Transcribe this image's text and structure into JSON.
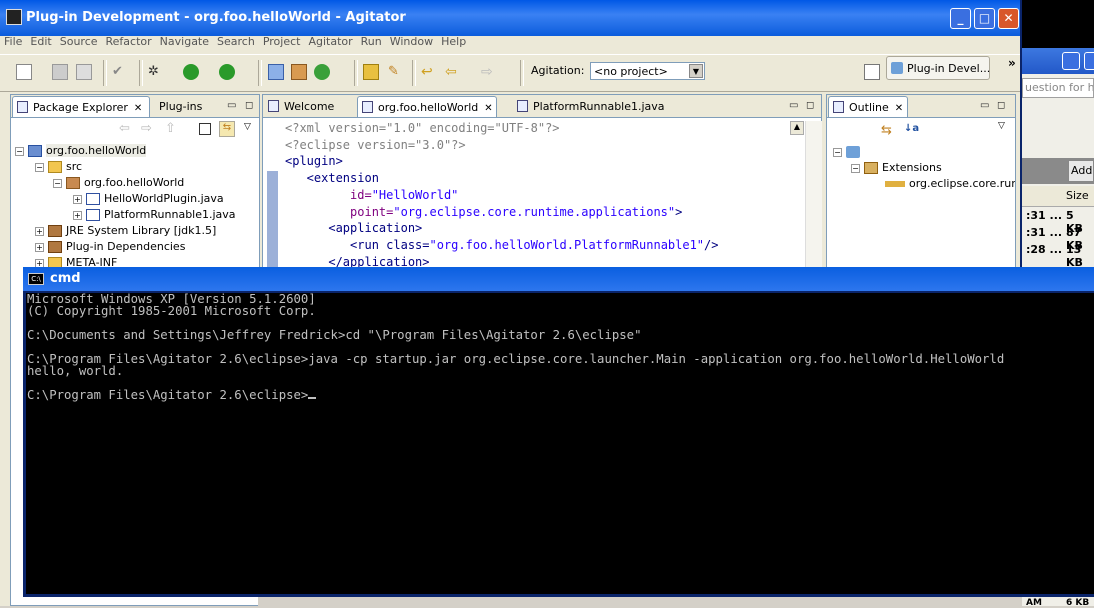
{
  "background_window": {
    "question_field": "uestion for hel",
    "add_button": "Add",
    "size_header": "Size",
    "rows": [
      {
        "time": ":31 ...",
        "size": "5 KB"
      },
      {
        "time": ":31 ...",
        "size": "87 KB"
      },
      {
        "time": ":28 ...",
        "size": "13 KB"
      }
    ],
    "bottom_time": "AM",
    "bottom_size": "6 KB"
  },
  "window": {
    "title": "Plug-in Development - org.foo.helloWorld - Agitator",
    "minimize": "_",
    "maximize": "□",
    "close": "✕"
  },
  "menu": [
    "File",
    "Edit",
    "Source",
    "Refactor",
    "Navigate",
    "Search",
    "Project",
    "Agitator",
    "Run",
    "Window",
    "Help"
  ],
  "toolbar": {
    "agitation_label": "Agitation:",
    "project_combo": "<no project>",
    "perspective": "Plug-in Devel...",
    "overflow": "»"
  },
  "package_explorer": {
    "tabs": [
      {
        "label": "Package Explorer",
        "close": "✕"
      },
      {
        "label": "Plug-ins"
      }
    ],
    "tree": [
      {
        "label": "org.foo.helloWorld",
        "exp": "−",
        "icon": "project-icon",
        "level": 0
      },
      {
        "label": "src",
        "exp": "−",
        "icon": "source-folder-icon",
        "level": 1
      },
      {
        "label": "org.foo.helloWorld",
        "exp": "−",
        "icon": "package-icon",
        "level": 2
      },
      {
        "label": "HelloWorldPlugin.java",
        "exp": "+",
        "icon": "java-file-icon",
        "level": 3
      },
      {
        "label": "PlatformRunnable1.java",
        "exp": "+",
        "icon": "java-file-icon",
        "level": 3
      },
      {
        "label": "JRE System Library [jdk1.5]",
        "exp": "+",
        "icon": "library-icon",
        "level": 1
      },
      {
        "label": "Plug-in Dependencies",
        "exp": "+",
        "icon": "library-icon",
        "level": 1
      },
      {
        "label": "META-INF",
        "exp": "+",
        "icon": "folder-icon",
        "level": 1
      }
    ]
  },
  "editor": {
    "tabs": [
      {
        "label": "Welcome"
      },
      {
        "label": "org.foo.helloWorld",
        "close": "✕"
      },
      {
        "label": "PlatformRunnable1.java"
      }
    ],
    "lines": [
      {
        "t1": "<?xml version=\"1.0\" encoding=\"UTF-8\"?>"
      },
      {
        "t1": "<?eclipse version=\"3.0\"?>"
      },
      {
        "t1": "<plugin>"
      },
      {
        "t1": "   <extension"
      },
      {
        "t1": "         id=",
        "t2": "\"HelloWorld\""
      },
      {
        "t1": "         point=",
        "t2": "\"org.eclipse.core.runtime.applications\"",
        "t3": ">"
      },
      {
        "t1": "      <application>"
      },
      {
        "t1": "         <run class=",
        "t2": "\"org.foo.helloWorld.PlatformRunnable1\"",
        "t3": "/>"
      },
      {
        "t1": "      </application>"
      }
    ]
  },
  "outline": {
    "tab": {
      "label": "Outline",
      "close": "✕"
    },
    "tree": [
      {
        "label": "",
        "level": 0
      },
      {
        "label": "Extensions",
        "level": 1
      },
      {
        "label": "org.eclipse.core.runtime.applications",
        "level": 2
      }
    ]
  },
  "cmd": {
    "title": "cmd",
    "icon_text": "C:\\",
    "output": "Microsoft Windows XP [Version 5.1.2600]\n(C) Copyright 1985-2001 Microsoft Corp.\n\nC:\\Documents and Settings\\Jeffrey Fredrick>cd \"\\Program Files\\Agitator 2.6\\eclipse\"\n\nC:\\Program Files\\Agitator 2.6\\eclipse>java -cp startup.jar org.eclipse.core.launcher.Main -application org.foo.helloWorld.HelloWorld\nhello, world.\n\nC:\\Program Files\\Agitator 2.6\\eclipse>"
  }
}
